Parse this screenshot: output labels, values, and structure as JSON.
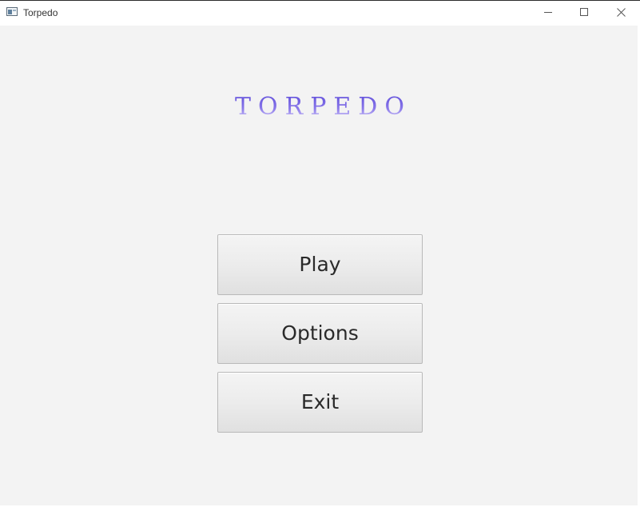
{
  "window": {
    "title": "Torpedo",
    "app_icon": "window-app-icon",
    "controls": {
      "minimize_icon": "minimize-icon",
      "maximize_icon": "maximize-icon",
      "close_icon": "close-icon"
    }
  },
  "main": {
    "game_title": "TORPEDO",
    "title_colors": {
      "top": "#5a48d8",
      "bottom": "#e6e2fb"
    },
    "menu": {
      "play_label": "Play",
      "options_label": "Options",
      "exit_label": "Exit"
    }
  },
  "colors": {
    "background": "#f3f3f3",
    "button_text": "#2a2a2a",
    "button_border": "#b9b9b9"
  }
}
